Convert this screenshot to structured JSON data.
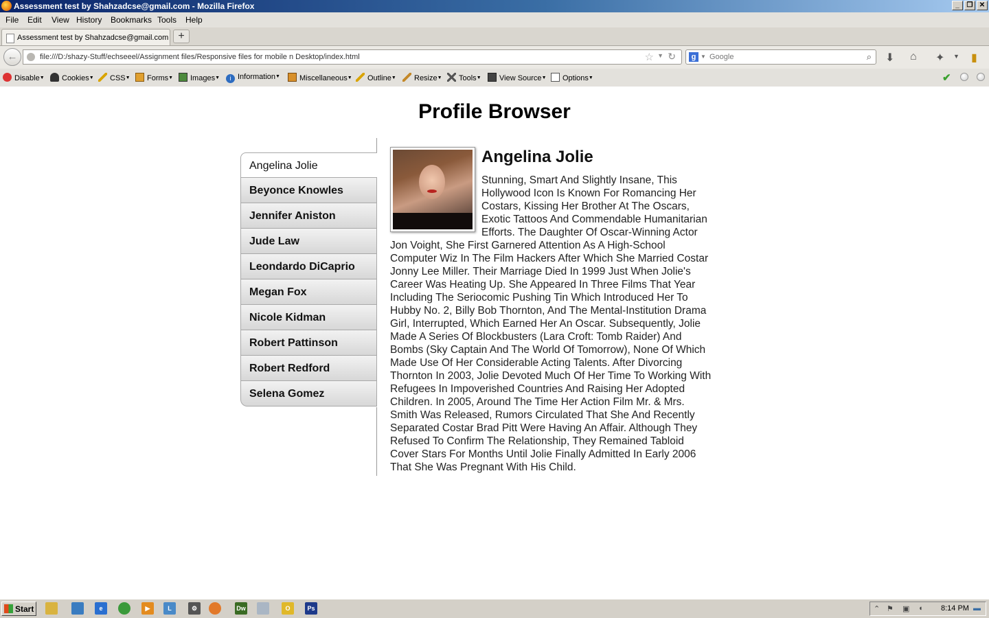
{
  "window": {
    "title": "Assessment test by Shahzadcse@gmail.com - Mozilla Firefox"
  },
  "menu": [
    "File",
    "Edit",
    "View",
    "History",
    "Bookmarks",
    "Tools",
    "Help"
  ],
  "tab": {
    "title": "Assessment test by Shahzadcse@gmail.com",
    "new_tab_label": "+"
  },
  "nav": {
    "url": "file:///D:/shazy-Stuff/echseeel/Assignment files/Responsive files for mobile n Desktop/index.html",
    "search_placeholder": "Google",
    "search_engine_icon": "google-icon"
  },
  "devbar": [
    "Disable",
    "Cookies",
    "CSS",
    "Forms",
    "Images",
    "Information",
    "Miscellaneous",
    "Outline",
    "Resize",
    "Tools",
    "View Source",
    "Options"
  ],
  "page": {
    "title": "Profile Browser",
    "profiles": [
      "Angelina Jolie",
      "Beyonce Knowles",
      "Jennifer Aniston",
      "Jude Law",
      "Leondardo DiCaprio",
      "Megan Fox",
      "Nicole Kidman",
      "Robert Pattinson",
      "Robert Redford",
      "Selena Gomez"
    ],
    "selected_profile": "Angelina Jolie",
    "profile": {
      "name": "Angelina Jolie",
      "bio": "Stunning, Smart And Slightly Insane, This Hollywood Icon Is Known For Romancing Her Costars, Kissing Her Brother At The Oscars, Exotic Tattoos And Commendable Humanitarian Efforts. The Daughter Of Oscar-Winning Actor Jon Voight, She First Garnered Attention As A High-School Computer Wiz In The Film Hackers After Which She Married Costar Jonny Lee Miller. Their Marriage Died In 1999 Just When Jolie's Career Was Heating Up. She Appeared In Three Films That Year Including The Seriocomic Pushing Tin Which Introduced Her To Hubby No. 2, Billy Bob Thornton, And The Mental-Institution Drama Girl, Interrupted, Which Earned Her An Oscar. Subsequently, Jolie Made A Series Of Blockbusters (Lara Croft: Tomb Raider) And Bombs (Sky Captain And The World Of Tomorrow), None Of Which Made Use Of Her Considerable Acting Talents. After Divorcing Thornton In 2003, Jolie Devoted Much Of Her Time To Working With Refugees In Impoverished Countries And Raising Her Adopted Children. In 2005, Around The Time Her Action Film Mr. & Mrs. Smith Was Released, Rumors Circulated That She And Recently Separated Costar Brad Pitt Were Having An Affair. Although They Refused To Confirm The Relationship, They Remained Tabloid Cover Stars For Months Until Jolie Finally Admitted In Early 2006 That She Was Pregnant With His Child."
    }
  },
  "taskbar": {
    "start_label": "Start",
    "time": "8:14 PM",
    "apps": [
      "Dw",
      "Ps"
    ]
  }
}
